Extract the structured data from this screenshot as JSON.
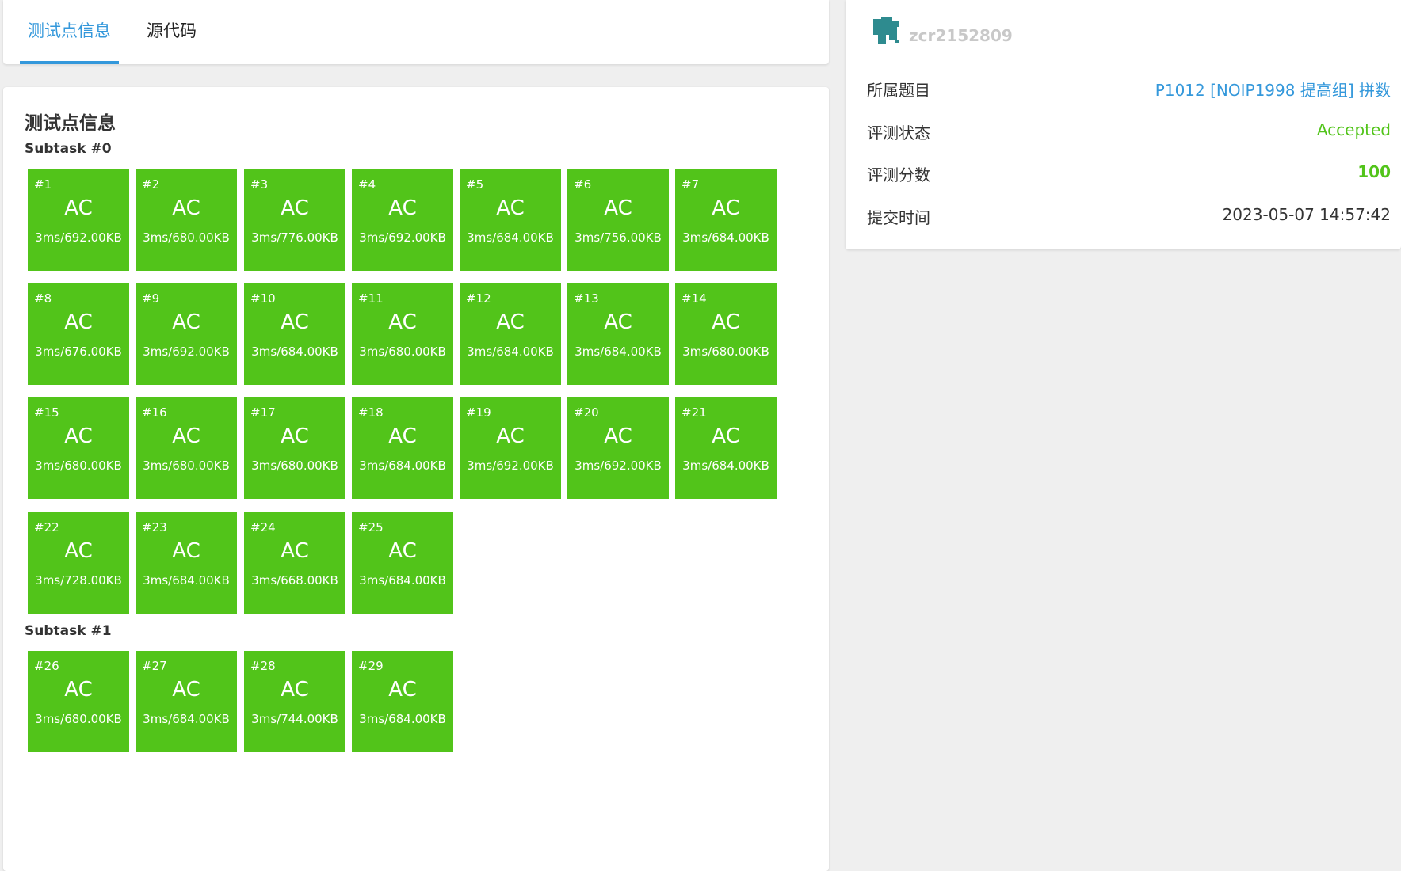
{
  "tabs": [
    {
      "label": "测试点信息",
      "active": true
    },
    {
      "label": "源代码",
      "active": false
    }
  ],
  "main": {
    "title": "测试点信息",
    "subtasks": [
      {
        "title": "Subtask #0",
        "cases": [
          {
            "num": "#1",
            "status": "AC",
            "meta": "3ms/692.00KB"
          },
          {
            "num": "#2",
            "status": "AC",
            "meta": "3ms/680.00KB"
          },
          {
            "num": "#3",
            "status": "AC",
            "meta": "3ms/776.00KB"
          },
          {
            "num": "#4",
            "status": "AC",
            "meta": "3ms/692.00KB"
          },
          {
            "num": "#5",
            "status": "AC",
            "meta": "3ms/684.00KB"
          },
          {
            "num": "#6",
            "status": "AC",
            "meta": "3ms/756.00KB"
          },
          {
            "num": "#7",
            "status": "AC",
            "meta": "3ms/684.00KB"
          },
          {
            "num": "#8",
            "status": "AC",
            "meta": "3ms/676.00KB"
          },
          {
            "num": "#9",
            "status": "AC",
            "meta": "3ms/692.00KB"
          },
          {
            "num": "#10",
            "status": "AC",
            "meta": "3ms/684.00KB"
          },
          {
            "num": "#11",
            "status": "AC",
            "meta": "3ms/680.00KB"
          },
          {
            "num": "#12",
            "status": "AC",
            "meta": "3ms/684.00KB"
          },
          {
            "num": "#13",
            "status": "AC",
            "meta": "3ms/684.00KB"
          },
          {
            "num": "#14",
            "status": "AC",
            "meta": "3ms/680.00KB"
          },
          {
            "num": "#15",
            "status": "AC",
            "meta": "3ms/680.00KB"
          },
          {
            "num": "#16",
            "status": "AC",
            "meta": "3ms/680.00KB"
          },
          {
            "num": "#17",
            "status": "AC",
            "meta": "3ms/680.00KB"
          },
          {
            "num": "#18",
            "status": "AC",
            "meta": "3ms/684.00KB"
          },
          {
            "num": "#19",
            "status": "AC",
            "meta": "3ms/692.00KB"
          },
          {
            "num": "#20",
            "status": "AC",
            "meta": "3ms/692.00KB"
          },
          {
            "num": "#21",
            "status": "AC",
            "meta": "3ms/684.00KB"
          },
          {
            "num": "#22",
            "status": "AC",
            "meta": "3ms/728.00KB"
          },
          {
            "num": "#23",
            "status": "AC",
            "meta": "3ms/684.00KB"
          },
          {
            "num": "#24",
            "status": "AC",
            "meta": "3ms/668.00KB"
          },
          {
            "num": "#25",
            "status": "AC",
            "meta": "3ms/684.00KB"
          }
        ]
      },
      {
        "title": "Subtask #1",
        "cases": [
          {
            "num": "#26",
            "status": "AC",
            "meta": "3ms/680.00KB"
          },
          {
            "num": "#27",
            "status": "AC",
            "meta": "3ms/684.00KB"
          },
          {
            "num": "#28",
            "status": "AC",
            "meta": "3ms/744.00KB"
          },
          {
            "num": "#29",
            "status": "AC",
            "meta": "3ms/684.00KB"
          }
        ]
      }
    ]
  },
  "sidebar": {
    "username": "zcr2152809",
    "rows": [
      {
        "label": "所属题目",
        "value": "P1012 [NOIP1998 提高组] 拼数"
      },
      {
        "label": "评测状态",
        "value": "Accepted"
      },
      {
        "label": "评测分数",
        "value": "100"
      },
      {
        "label": "提交时间",
        "value": "2023-05-07 14:57:42"
      }
    ]
  },
  "colors": {
    "accent": "#3498db",
    "ac_green": "#52c41a",
    "avatar_teal": "#2e8b8f"
  }
}
